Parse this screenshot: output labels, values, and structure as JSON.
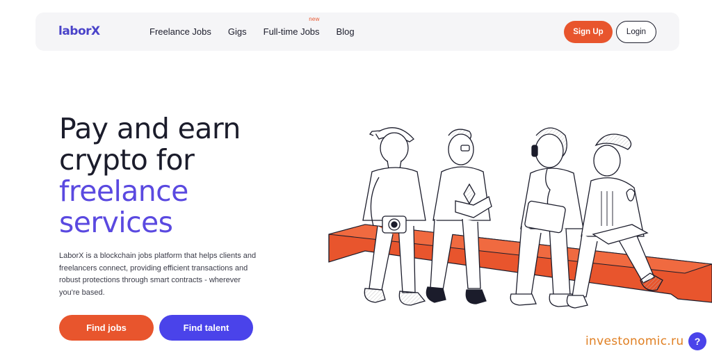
{
  "header": {
    "logo": "laborX",
    "nav": [
      {
        "label": "Freelance Jobs",
        "badge": ""
      },
      {
        "label": "Gigs",
        "badge": ""
      },
      {
        "label": "Full-time Jobs",
        "badge": "new"
      },
      {
        "label": "Blog",
        "badge": ""
      }
    ],
    "signup_label": "Sign Up",
    "login_label": "Login"
  },
  "hero": {
    "title_line1": "Pay and earn",
    "title_line2": "crypto for",
    "title_line3": "freelance",
    "title_line4": "services",
    "description": "LaborX is a blockchain jobs platform that helps clients and freelancers connect, providing efficient transactions and robust protections through smart contracts - wherever you're based.",
    "find_jobs_label": "Find jobs",
    "find_talent_label": "Find talent"
  },
  "watermark": "investonomic.ru",
  "help_label": "?",
  "colors": {
    "accent_orange": "#e8552d",
    "accent_blue": "#4a43ea",
    "title_purple": "#5a49e0"
  },
  "icons": {
    "illustration": "four-people-sitting-on-bench-illustration",
    "help": "question-mark-icon"
  }
}
